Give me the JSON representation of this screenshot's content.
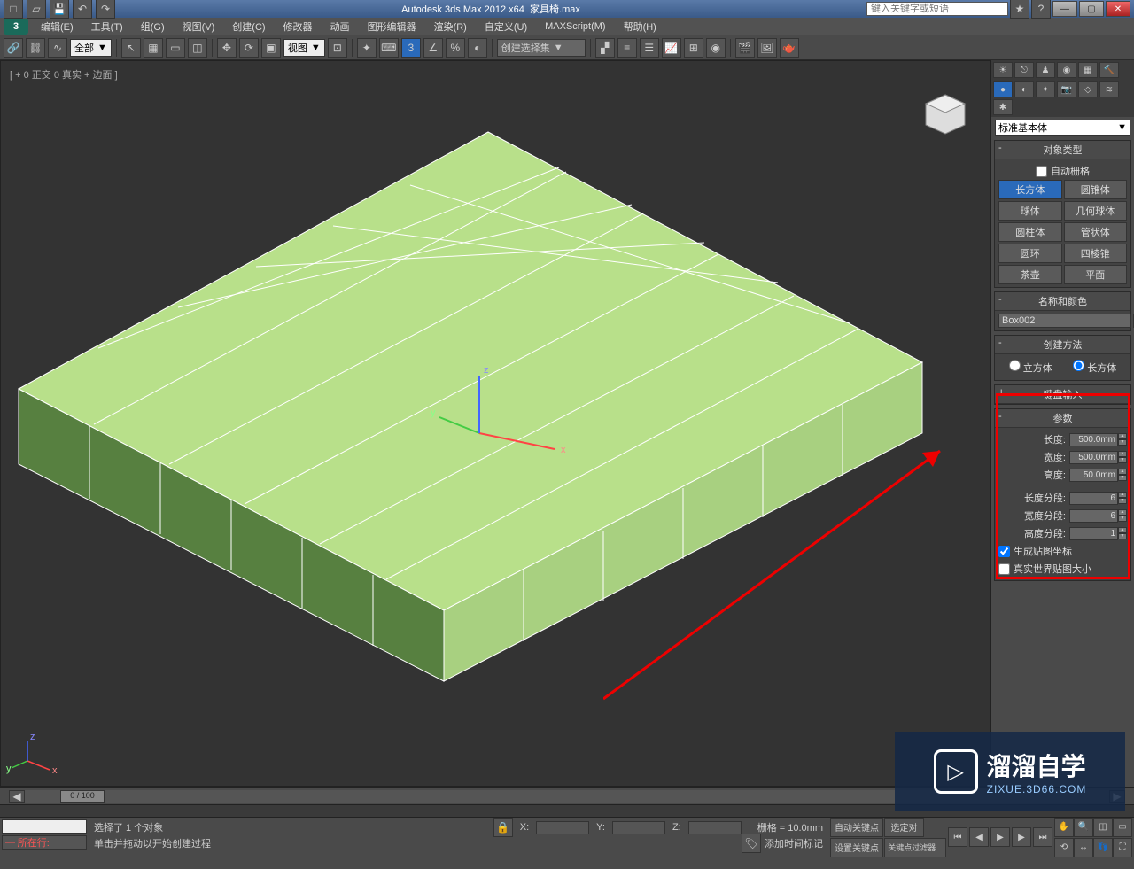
{
  "titlebar": {
    "app": "Autodesk 3ds Max  2012 x64",
    "file": "家具椅.max",
    "search_placeholder": "键入关键字或短语"
  },
  "menubar": {
    "items": [
      "编辑(E)",
      "工具(T)",
      "组(G)",
      "视图(V)",
      "创建(C)",
      "修改器",
      "动画",
      "图形编辑器",
      "渲染(R)",
      "自定义(U)",
      "MAXScript(M)",
      "帮助(H)"
    ]
  },
  "toolbar": {
    "filter_all": "全部",
    "view_dd": "视图",
    "create_set": "创建选择集"
  },
  "viewport": {
    "label": "[ + 0 正交 0 真实 + 边面 ]",
    "axis_x": "x",
    "axis_y": "y",
    "axis_z": "z"
  },
  "command_panel": {
    "category": "标准基本体",
    "rollouts": {
      "obj_type": "对象类型",
      "auto_grid": "自动栅格",
      "name_color": "名称和颜色",
      "create_method": "创建方法",
      "keyboard": "键盘输入",
      "parameters": "参数"
    },
    "objects": [
      "长方体",
      "圆锥体",
      "球体",
      "几何球体",
      "圆柱体",
      "管状体",
      "圆环",
      "四棱锥",
      "茶壶",
      "平面"
    ],
    "object_active_index": 0,
    "name": "Box002",
    "create_method": {
      "opt1": "立方体",
      "opt2": "长方体"
    },
    "params": {
      "length_lbl": "长度:",
      "length_val": "500.0mm",
      "width_lbl": "宽度:",
      "width_val": "500.0mm",
      "height_lbl": "高度:",
      "height_val": "50.0mm",
      "lseg_lbl": "长度分段:",
      "lseg_val": "6",
      "wseg_lbl": "宽度分段:",
      "wseg_val": "6",
      "hseg_lbl": "高度分段:",
      "hseg_val": "1",
      "gen_map": "生成贴图坐标",
      "real_world": "真实世界贴图大小"
    }
  },
  "timeline": {
    "handle": "0 / 100"
  },
  "status": {
    "now_at": "所在行:",
    "selected": "选择了 1 个对象",
    "drag_hint": "单击并拖动以开始创建过程",
    "x": "X:",
    "y": "Y:",
    "z": "Z:",
    "grid": "栅格 = 10.0mm",
    "add_time": "添加时间标记",
    "autokey": "自动关键点",
    "selected_pair": "选定对",
    "setkey": "设置关键点",
    "keyfilter": "关键点过滤器..."
  },
  "watermark": {
    "big": "溜溜自学",
    "small": "ZIXUE.3D66.COM"
  }
}
